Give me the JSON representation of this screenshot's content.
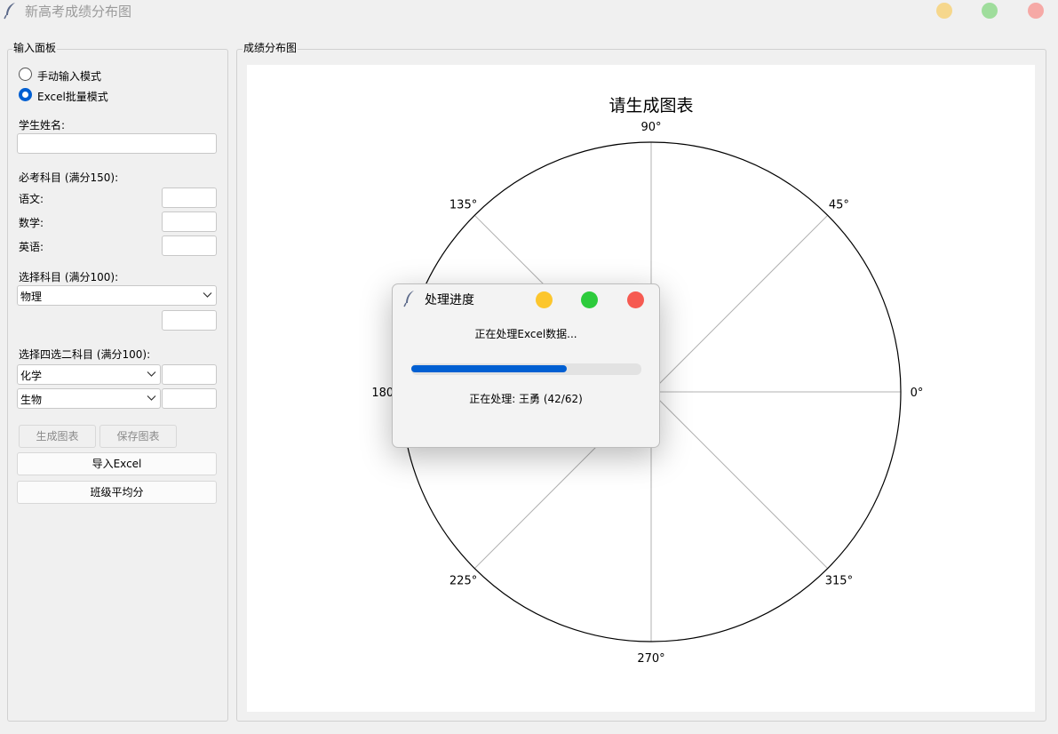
{
  "window": {
    "title": "新高考成绩分布图",
    "controls": [
      "minimize",
      "maximize",
      "close"
    ],
    "control_colors": {
      "minimize": "#f6d78c",
      "maximize": "#9fdd9c",
      "close": "#f6a9a6"
    }
  },
  "input_panel": {
    "title": "输入面板",
    "modes": [
      {
        "label": "手动输入模式",
        "selected": false
      },
      {
        "label": "Excel批量模式",
        "selected": true
      }
    ],
    "student_name_label": "学生姓名:",
    "student_name_value": "",
    "required_label": "必考科目 (满分150):",
    "required_subjects": [
      {
        "label": "语文:",
        "value": ""
      },
      {
        "label": "数学:",
        "value": ""
      },
      {
        "label": "英语:",
        "value": ""
      }
    ],
    "elective_label": "选择科目 (满分100):",
    "elective_subject": "物理",
    "elective_score": "",
    "choose_two_label": "选择四选二科目 (满分100):",
    "choose_two": [
      {
        "subject": "化学",
        "score": ""
      },
      {
        "subject": "生物",
        "score": ""
      }
    ],
    "buttons": {
      "generate": "生成图表",
      "save": "保存图表",
      "import_excel": "导入Excel",
      "class_average": "班级平均分"
    }
  },
  "chart_panel": {
    "title": "成绩分布图"
  },
  "chart_data": {
    "type": "polar",
    "title": "请生成图表",
    "angle_ticks": [
      "0°",
      "45°",
      "90°",
      "135°",
      "180°",
      "225°",
      "270°",
      "315°"
    ],
    "series": [],
    "grid": true
  },
  "dialog": {
    "title": "处理进度",
    "message": "正在处理Excel数据...",
    "progress_fraction": 0.677,
    "status": "正在处理: 王勇 (42/62)",
    "control_colors": {
      "minimize": "#fcc62d",
      "maximize": "#2dcb3c",
      "close": "#f65a51"
    }
  },
  "colors": {
    "accent": "#005fd2",
    "background": "#f0f0f0",
    "disabled_text": "#8a8a8a"
  }
}
